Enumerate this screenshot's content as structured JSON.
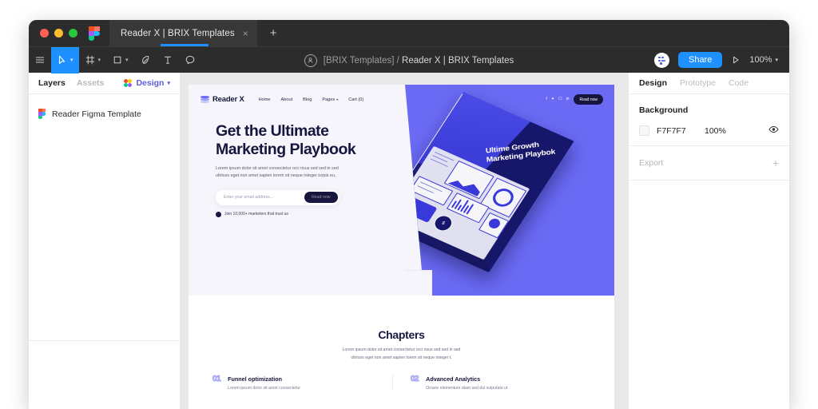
{
  "window": {
    "traffic_lights": [
      "close",
      "minimize",
      "maximize"
    ],
    "app_logo": "figma-logo",
    "tab": {
      "title": "Reader X | BRIX Templates",
      "close": "×"
    },
    "new_tab": "+"
  },
  "toolbar": {
    "menu_icon": "hamburger-icon",
    "tools": [
      {
        "name": "move-tool",
        "icon": "cursor-icon",
        "caret": "▾",
        "active": true
      },
      {
        "name": "frame-tool",
        "icon": "frame-icon",
        "caret": "▾",
        "active": false
      },
      {
        "name": "shape-tool",
        "icon": "square-icon",
        "caret": "▾",
        "active": false
      },
      {
        "name": "pen-tool",
        "icon": "pen-icon",
        "caret": "",
        "active": false
      },
      {
        "name": "text-tool",
        "icon": "text-icon",
        "caret": "",
        "active": false
      },
      {
        "name": "comment-tool",
        "icon": "comment-icon",
        "caret": "",
        "active": false
      }
    ],
    "breadcrumb_project": "[BRIX Templates] /",
    "breadcrumb_file": "Reader X | BRIX Templates",
    "share_label": "Share",
    "present_icon": "play-icon",
    "zoom_level": "100%",
    "zoom_caret": "▾"
  },
  "left_panel": {
    "tabs": [
      {
        "label": "Layers",
        "active": true
      },
      {
        "label": "Assets",
        "active": false
      }
    ],
    "design_label": "Design",
    "design_caret": "▾",
    "layers": [
      {
        "name": "Reader Figma Template",
        "icon": "figma-component-icon"
      }
    ]
  },
  "right_panel": {
    "tabs": [
      {
        "label": "Design",
        "active": true
      },
      {
        "label": "Prototype",
        "active": false
      },
      {
        "label": "Code",
        "active": false
      }
    ],
    "background": {
      "heading": "Background",
      "hex": "F7F7F7",
      "opacity": "100%",
      "visibility_icon": "eye-icon"
    },
    "export": {
      "label": "Export",
      "add_icon": "+"
    }
  },
  "canvas": {
    "site": {
      "nav": {
        "brand": "Reader X",
        "links": [
          {
            "label": "Home",
            "caret": ""
          },
          {
            "label": "About",
            "caret": ""
          },
          {
            "label": "Blog",
            "caret": ""
          },
          {
            "label": "Pages",
            "caret": "▾"
          },
          {
            "label": "Cart (0)",
            "caret": ""
          }
        ],
        "social": [
          "f",
          "•",
          "□",
          "in"
        ],
        "cta": "Read now"
      },
      "hero": {
        "headline_line1": "Get the Ultimate",
        "headline_line2": "Marketing Playbook",
        "body_line1": "Lorem ipsum dolor sit amet consectetur orci risus sed sed in sed",
        "body_line2": "ultrices eget non amet sapien lorem sit neque integer turpis eu.",
        "email_placeholder": "Enter your email address...",
        "email_cta": "Read now",
        "trust_check": "✓",
        "trust_text": "Join 10,000+ marketers that trust us"
      },
      "book": {
        "title_line1": "Ultime Growth",
        "title_line2": "Marketing Playbok",
        "coin_symbol": "$"
      },
      "chapters": {
        "title": "Chapters",
        "sub_line1": "Lorem ipsum dolor sit amet consectetur orci risus sed sed in sed",
        "sub_line2": "ultrices eget non amet sapien lorem sit neque integer t.",
        "features": [
          {
            "number": "01",
            "heading": "Funnel optimization",
            "body": "Lorem ipsum dolor sit amet consectetur"
          },
          {
            "number": "02",
            "heading": "Advanced Analytics",
            "body": "Ornare elementum diam sed dui vulputate ut"
          }
        ]
      }
    }
  },
  "colors": {
    "accent_blue": "#1e90ff",
    "brand_purple": "#6a6af4",
    "ink": "#16163f",
    "chrome_dark": "#2c2c2c",
    "canvas_gray": "#e9e9e9",
    "hero_bg": "#f5f5fb"
  }
}
